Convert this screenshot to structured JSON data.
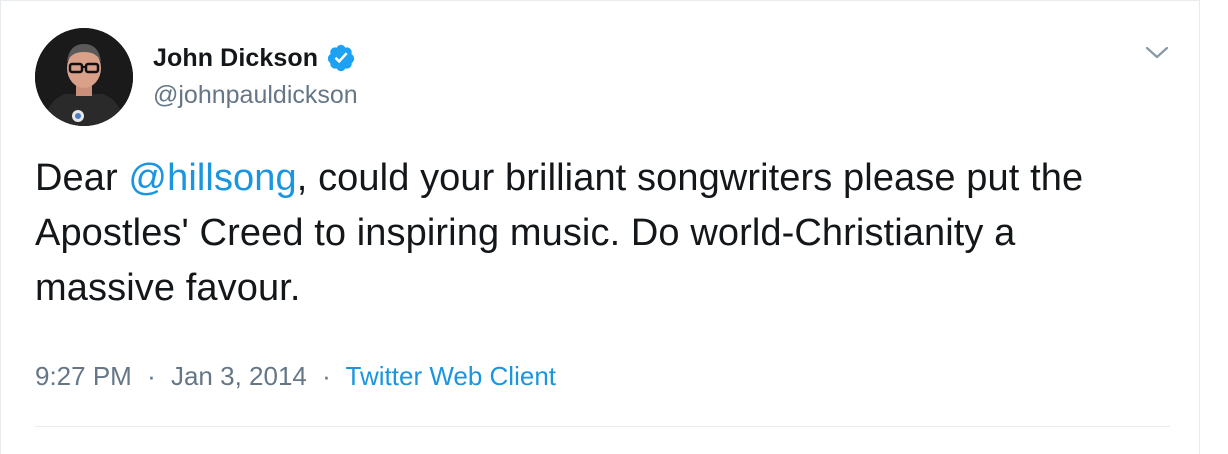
{
  "user": {
    "display_name": "John Dickson",
    "handle": "@johnpauldickson",
    "verified": true
  },
  "tweet": {
    "text_before": "Dear ",
    "mention": "@hillsong",
    "text_after": ", could your brilliant songwriters please put the Apostles' Creed to inspiring music. Do world-Christianity a massive favour."
  },
  "meta": {
    "time": "9:27 PM",
    "separator": "·",
    "date": "Jan 3, 2014",
    "source": "Twitter Web Client"
  },
  "colors": {
    "link": "#1b95e0",
    "secondary_text": "#657786",
    "primary_text": "#14171a",
    "verified_badge": "#1da1f2"
  },
  "icons": {
    "avatar": "profile-photo",
    "verified": "verified-badge-icon",
    "caret": "chevron-down-icon"
  }
}
